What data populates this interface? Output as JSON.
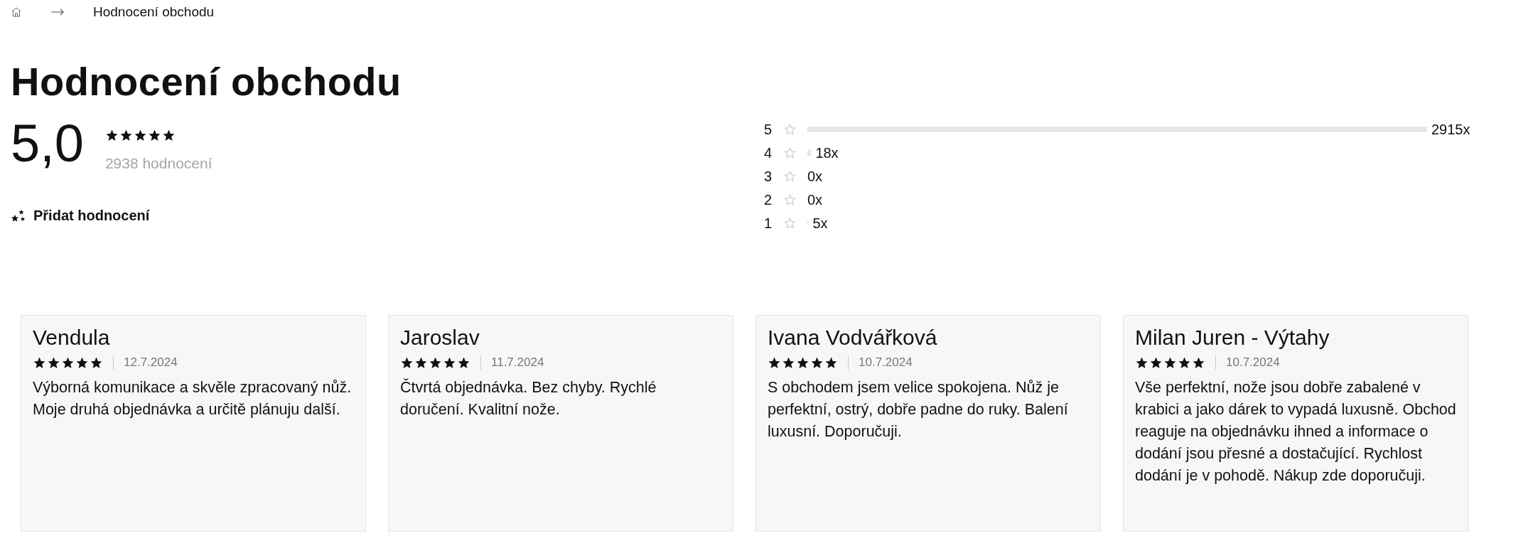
{
  "breadcrumb": {
    "current": "Hodnocení obchodu"
  },
  "title": "Hodnocení obchodu",
  "summary": {
    "score": "5,0",
    "stars": 5,
    "count": "2938 hodnocení",
    "add_label": "Přidat hodnocení"
  },
  "distribution": {
    "chart_data": {
      "type": "bar",
      "orientation": "horizontal",
      "categories": [
        "5",
        "4",
        "3",
        "2",
        "1"
      ],
      "values": [
        2915,
        18,
        0,
        0,
        5
      ],
      "value_labels": [
        "2915x",
        "18x",
        "0x",
        "0x",
        "5x"
      ]
    }
  },
  "reviews": [
    {
      "name": "Vendula",
      "stars": 5,
      "date": "12.7.2024",
      "text": "Výborná komunikace a skvěle zpracovaný nůž. Moje druhá objednávka a určitě plánuju další."
    },
    {
      "name": "Jaroslav",
      "stars": 5,
      "date": "11.7.2024",
      "text": "Čtvrtá objednávka. Bez chyby. Rychlé doručení. Kvalitní nože."
    },
    {
      "name": "Ivana Vodvářková",
      "stars": 5,
      "date": "10.7.2024",
      "text": "S obchodem jsem velice spokojena. Nůž je perfektní, ostrý, dobře padne do ruky. Balení luxusní. Doporučuji."
    },
    {
      "name": "Milan Juren - Výtahy",
      "stars": 5,
      "date": "10.7.2024",
      "text": "Vše perfektní, nože jsou dobře zabalené v krabici a jako dárek to vypadá luxusně. Obchod reaguje na objednávku ihned a informace o dodání jsou přesné a dostačující. Rychlost dodání je v pohodě. Nákup zde doporučuji."
    }
  ]
}
